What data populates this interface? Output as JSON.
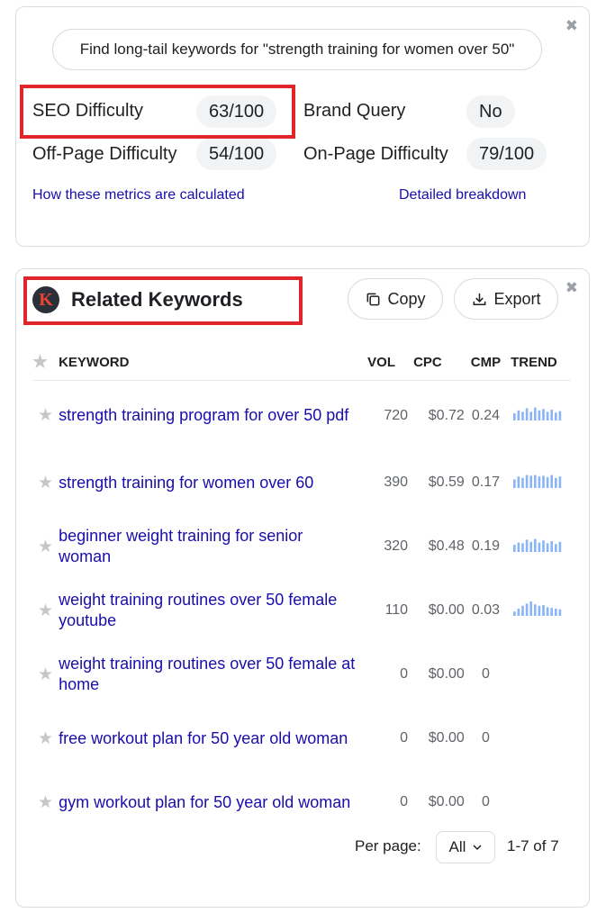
{
  "metrics_card": {
    "close_icon": "close-icon",
    "longtail_button": "Find long-tail keywords for \"strength training for women over 50\"",
    "seo_difficulty_label": "SEO Difficulty",
    "seo_difficulty_value": "63/100",
    "brand_query_label": "Brand Query",
    "brand_query_value": "No",
    "offpage_label": "Off-Page Difficulty",
    "offpage_value": "54/100",
    "onpage_label": "On-Page Difficulty",
    "onpage_value": "79/100",
    "how_link": "How these metrics are calculated",
    "breakdown_link": "Detailed breakdown"
  },
  "related_card": {
    "logo_letter": "K",
    "title": "Related Keywords",
    "copy_label": "Copy",
    "export_label": "Export",
    "close_icon": "close-icon",
    "columns": {
      "keyword": "KEYWORD",
      "vol": "VOL",
      "cpc": "CPC",
      "cmp": "CMP",
      "trend": "TREND"
    },
    "rows": [
      {
        "keyword": "strength training program for over 50 pdf",
        "vol": "720",
        "cpc": "$0.72",
        "cmp": "0.24",
        "trend": [
          0.5,
          0.7,
          0.6,
          0.85,
          0.6,
          0.9,
          0.7,
          0.8,
          0.6,
          0.75,
          0.55,
          0.65
        ]
      },
      {
        "keyword": "strength training for women over 60",
        "vol": "390",
        "cpc": "$0.59",
        "cmp": "0.17",
        "trend": [
          0.6,
          0.8,
          0.7,
          0.9,
          0.85,
          0.9,
          0.8,
          0.85,
          0.75,
          0.9,
          0.7,
          0.8
        ]
      },
      {
        "keyword": "beginner weight training for senior woman",
        "vol": "320",
        "cpc": "$0.48",
        "cmp": "0.19",
        "trend": [
          0.5,
          0.65,
          0.6,
          0.85,
          0.7,
          0.9,
          0.65,
          0.8,
          0.6,
          0.75,
          0.55,
          0.7
        ]
      },
      {
        "keyword": "weight training routines over 50 female youtube",
        "vol": "110",
        "cpc": "$0.00",
        "cmp": "0.03",
        "trend": [
          0.3,
          0.5,
          0.7,
          0.85,
          1.0,
          0.8,
          0.7,
          0.75,
          0.6,
          0.55,
          0.5,
          0.45
        ]
      },
      {
        "keyword": "weight training routines over 50 female at home",
        "vol": "0",
        "cpc": "$0.00",
        "cmp": "0",
        "trend": []
      },
      {
        "keyword": "free workout plan for 50 year old woman",
        "vol": "0",
        "cpc": "$0.00",
        "cmp": "0",
        "trend": []
      },
      {
        "keyword": "gym workout plan for 50 year old woman",
        "vol": "0",
        "cpc": "$0.00",
        "cmp": "0",
        "trend": []
      }
    ],
    "per_page_label": "Per page:",
    "per_page_value": "All",
    "range_text": "1-7 of 7"
  },
  "colors": {
    "link": "#1a0dab",
    "highlight": "#e0252b",
    "trend_bar": "#8ab4f8",
    "pill_bg": "#f1f3f4"
  }
}
